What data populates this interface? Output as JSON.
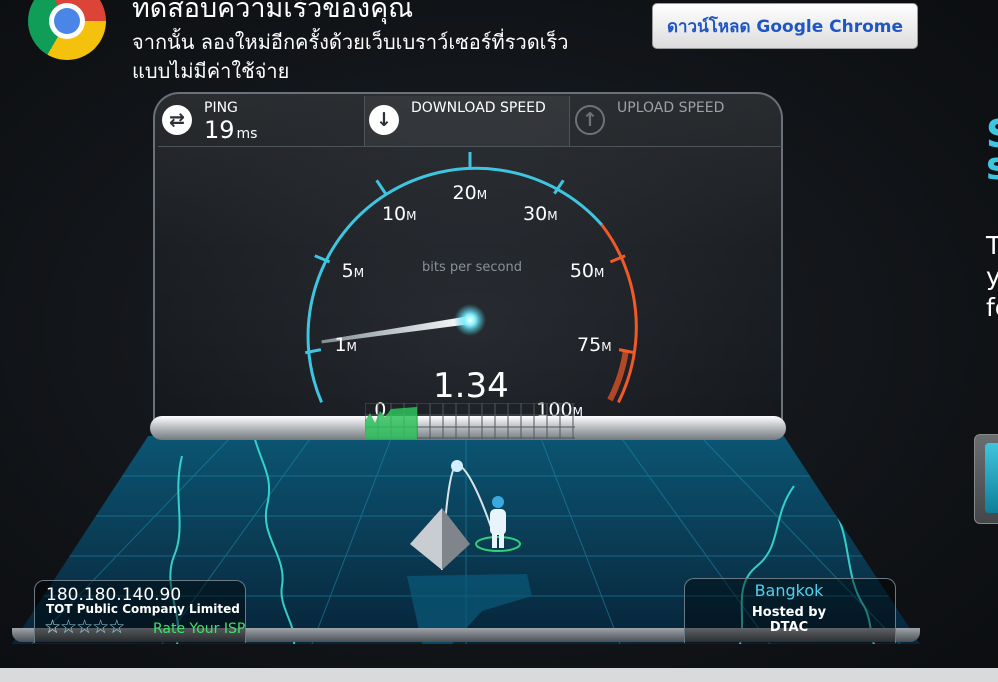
{
  "banner": {
    "title": "ทดสอบความเร็วของคุณ",
    "subtitle_line1": "จากนั้น ลองใหม่อีกครั้งด้วยเว็บเบราว์เซอร์ที่รวดเร็ว",
    "subtitle_line2": "แบบไม่มีค่าใช้จ่าย",
    "download_button": "ดาวน์โหลด Google Chrome"
  },
  "stats": {
    "ping_label": "PING",
    "ping_value": "19",
    "ping_unit": "ms",
    "download_label": "DOWNLOAD SPEED",
    "upload_label": "UPLOAD SPEED"
  },
  "gauge": {
    "scale_labels": [
      {
        "value": "0",
        "unit": ""
      },
      {
        "value": "1",
        "unit": "M"
      },
      {
        "value": "5",
        "unit": "M"
      },
      {
        "value": "10",
        "unit": "M"
      },
      {
        "value": "20",
        "unit": "M"
      },
      {
        "value": "30",
        "unit": "M"
      },
      {
        "value": "50",
        "unit": "M"
      },
      {
        "value": "75",
        "unit": "M"
      },
      {
        "value": "100",
        "unit": "M"
      }
    ],
    "units_caption": "bits per second",
    "current_reading": "1.34",
    "needle_value": 1.34
  },
  "client": {
    "ip": "180.180.140.90",
    "isp": "TOT Public Company Limited",
    "rating_stars": 5,
    "rating_filled": 1,
    "rate_link": "Rate Your ISP"
  },
  "server": {
    "city": "Bangkok",
    "hosted_by_label": "Hosted by",
    "host": "DTAC"
  },
  "edge_text": {
    "accent_line1": "S",
    "accent_line2": "s",
    "body_line1": "T",
    "body_line2": "y",
    "body_line3": "fo"
  },
  "colors": {
    "accent_blue": "#3ec6e0",
    "danger_orange": "#f05a28",
    "link_blue": "#1f56c4",
    "rate_green": "#3fe36a"
  }
}
